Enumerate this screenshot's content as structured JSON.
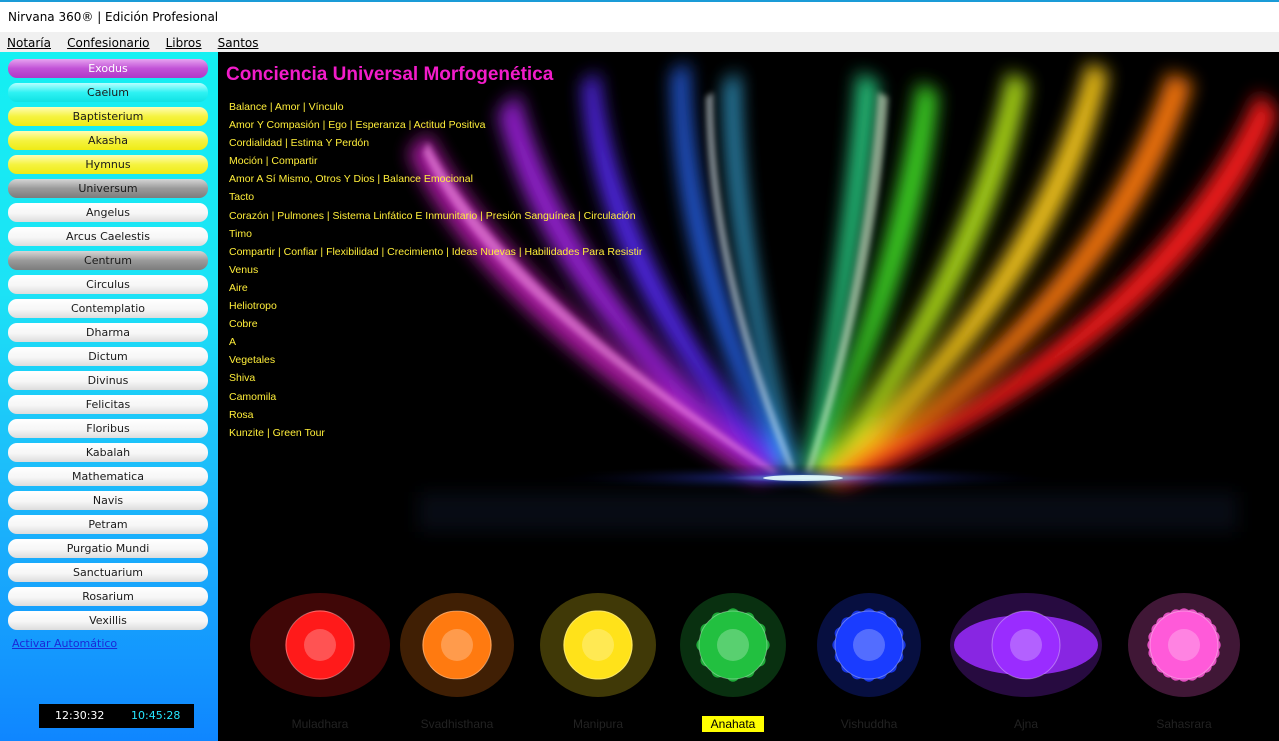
{
  "window": {
    "title": "Nirvana 360® | Edición Profesional"
  },
  "menu": [
    "Notaría",
    "Confesionario",
    "Libros",
    "Santos"
  ],
  "sidebar": {
    "items": [
      {
        "label": "Exodus",
        "style": "purple"
      },
      {
        "label": "Caelum",
        "style": "cyan"
      },
      {
        "label": "Baptisterium",
        "style": "yellow"
      },
      {
        "label": "Akasha",
        "style": "yellow"
      },
      {
        "label": "Hymnus",
        "style": "yellow"
      },
      {
        "label": "Universum",
        "style": "gray"
      },
      {
        "label": "Angelus",
        "style": "white"
      },
      {
        "label": "Arcus Caelestis",
        "style": "white"
      },
      {
        "label": "Centrum",
        "style": "gray"
      },
      {
        "label": "Circulus",
        "style": "white"
      },
      {
        "label": "Contemplatio",
        "style": "white"
      },
      {
        "label": "Dharma",
        "style": "white"
      },
      {
        "label": "Dictum",
        "style": "white"
      },
      {
        "label": "Divinus",
        "style": "white"
      },
      {
        "label": "Felicitas",
        "style": "white"
      },
      {
        "label": "Floribus",
        "style": "white"
      },
      {
        "label": "Kabalah",
        "style": "white"
      },
      {
        "label": "Mathematica",
        "style": "white"
      },
      {
        "label": "Navis",
        "style": "white"
      },
      {
        "label": "Petram",
        "style": "white"
      },
      {
        "label": "Purgatio Mundi",
        "style": "white"
      },
      {
        "label": "Sanctuarium",
        "style": "white"
      },
      {
        "label": "Rosarium",
        "style": "white"
      },
      {
        "label": "Vexillis",
        "style": "white"
      }
    ],
    "auto_link": "Activar Automático",
    "clock_local": "12:30:32",
    "clock_other": "10:45:28"
  },
  "main": {
    "title": "Conciencia Universal Morfogenética",
    "attributes": [
      "Balance | Amor | Vínculo",
      "Amor Y Compasión | Ego | Esperanza | Actitud Positiva",
      "Cordialidad | Estima Y Perdón",
      "Moción | Compartir",
      "Amor A Sí Mismo, Otros Y Dios | Balance Emocional",
      "Tacto",
      "Corazón | Pulmones | Sistema Linfático E Inmunitario | Presión Sanguínea | Circulación",
      "Timo",
      "Compartir | Confiar | Flexibilidad | Crecimiento | Ideas Nuevas | Habilidades Para Resistir",
      "Venus",
      "Aire",
      "Heliotropo",
      "Cobre",
      "A",
      "Vegetales",
      "Shiva",
      "Camomila",
      "Rosa",
      "Kunzite | Green Tour"
    ],
    "chakras": [
      {
        "name": "Muladhara",
        "color": "#ff1a1a",
        "active": false
      },
      {
        "name": "Svadhisthana",
        "color": "#ff7a10",
        "active": false
      },
      {
        "name": "Manipura",
        "color": "#ffe21a",
        "active": false
      },
      {
        "name": "Anahata",
        "color": "#22c040",
        "active": true
      },
      {
        "name": "Vishuddha",
        "color": "#1a3cff",
        "active": false
      },
      {
        "name": "Ajna",
        "color": "#9a2cff",
        "active": false
      },
      {
        "name": "Sahasrara",
        "color": "#ff5ad9",
        "active": false
      }
    ]
  }
}
